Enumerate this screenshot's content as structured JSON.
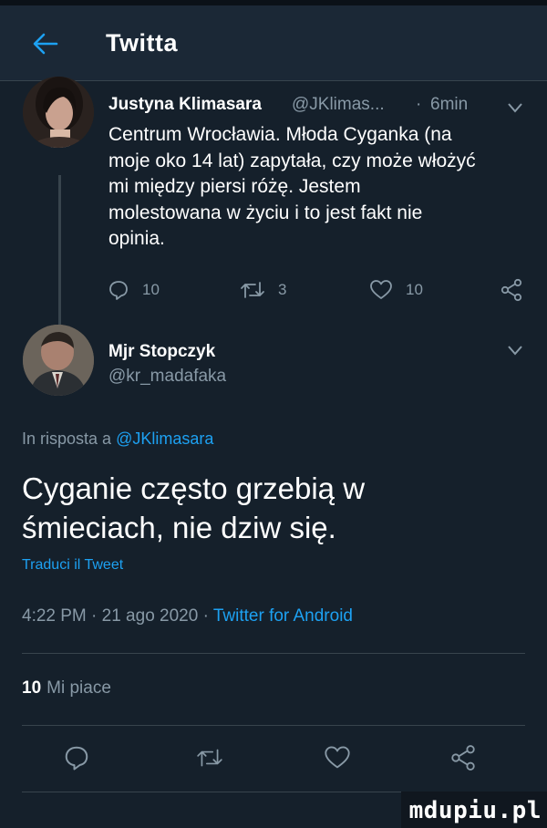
{
  "header": {
    "title": "Twitta",
    "back_icon": "arrow-left-icon"
  },
  "tweet_original": {
    "author_name": "Justyna Klimasara",
    "handle": "@JKlimas...",
    "separator": "·",
    "time": "6min",
    "text": "Centrum Wrocławia. Młoda Cyganka (na\nmoje oko 14 lat) zapytała, czy może włożyć\nmi między piersi różę. Jestem\nmolestowana w życiu i to jest fakt nie\nopinia.",
    "replies": "10",
    "retweets": "3",
    "likes": "10"
  },
  "tweet_reply": {
    "author_name": "Mjr Stopczyk",
    "handle": "@kr_madafaka",
    "reply_prefix": "In risposta a",
    "reply_mention": "@JKlimasara",
    "text": "Cyganie często grzebią w\nśmieciach, nie dziw się.",
    "translate": "Traduci il Tweet",
    "timestamp": "4:22 PM · 21 ago 2020 ·",
    "client": "Twitter for Android",
    "like_count": "10",
    "like_label": "Mi piace"
  },
  "watermark": "mdupiu.pl",
  "colors": {
    "background": "#15202b",
    "header": "#1b2836",
    "accent": "#1da1f2",
    "secondary_text": "#8899a6",
    "divider": "#38444d"
  },
  "icons": [
    "arrow-left-icon",
    "chevron-down-icon",
    "reply-icon",
    "retweet-icon",
    "heart-icon",
    "share-icon"
  ]
}
